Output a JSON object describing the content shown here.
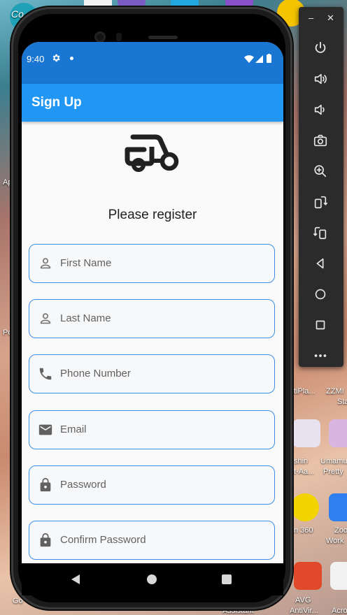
{
  "statusbar": {
    "time": "9:40"
  },
  "appbar": {
    "title": "Sign Up"
  },
  "main": {
    "heading": "Please register",
    "fields": [
      {
        "placeholder": "First Name",
        "icon": "person-icon"
      },
      {
        "placeholder": "Last Name",
        "icon": "person-icon"
      },
      {
        "placeholder": "Phone Number",
        "icon": "phone-icon"
      },
      {
        "placeholder": "Email",
        "icon": "email-icon"
      },
      {
        "placeholder": "Password",
        "icon": "lock-icon"
      },
      {
        "placeholder": "Confirm Password",
        "icon": "lock-icon"
      }
    ]
  },
  "emulator_toolbar": {
    "buttons": [
      "power-icon",
      "volume-up-icon",
      "volume-down-icon",
      "camera-icon",
      "zoom-in-icon",
      "rotate-left-icon",
      "rotate-right-icon",
      "back-icon",
      "home-icon",
      "overview-icon",
      "more-icon"
    ]
  },
  "desktop": {
    "labels": [
      "Co",
      "tiPla...",
      "ZZMI",
      "Sta",
      "shin",
      "t-Aa...",
      "Umamu",
      "Pretty",
      "n 360",
      "Zoo",
      "Work",
      "AVG",
      "AntiVir...",
      "Acro",
      "Assistant",
      "Go",
      "Po",
      "Ap"
    ]
  },
  "colors": {
    "statusbar": "#1976d2",
    "appbar": "#2196f3",
    "field_border": "#3d8fe6",
    "screen_bg": "#fafafa"
  }
}
